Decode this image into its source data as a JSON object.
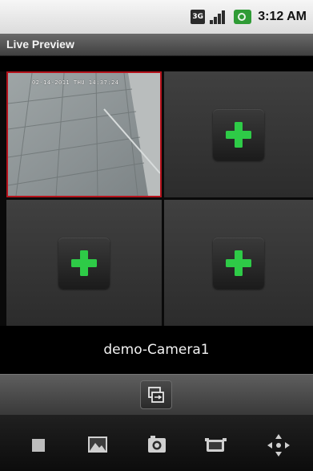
{
  "status_bar": {
    "network_label": "3G",
    "time": "3:12 AM"
  },
  "title_bar": {
    "title": "Live Preview"
  },
  "preview": {
    "cells": [
      {
        "name": "camera-feed",
        "timestamp": "02-14-2011 THU 14:37:24"
      },
      {
        "name": "add-camera-slot-2"
      },
      {
        "name": "add-camera-slot-3"
      },
      {
        "name": "add-camera-slot-4"
      }
    ]
  },
  "camera": {
    "selected_name": "demo-Camera1"
  },
  "toolbar": {
    "icons": [
      "stop-icon",
      "gallery-icon",
      "snapshot-icon",
      "record-icon",
      "ptz-icon"
    ]
  },
  "colors": {
    "selected_border": "#b5121b",
    "add_plus": "#2ecb47"
  }
}
